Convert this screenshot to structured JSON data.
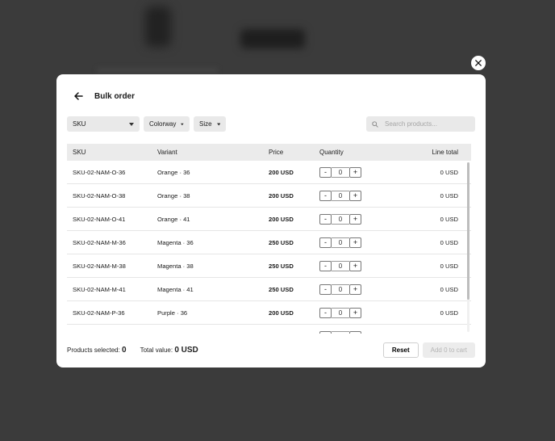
{
  "modal": {
    "title": "Bulk order"
  },
  "filters": {
    "sku": "SKU",
    "colorway": "Colorway",
    "size": "Size"
  },
  "search": {
    "placeholder": "Search products..."
  },
  "table": {
    "headers": {
      "sku": "SKU",
      "variant": "Variant",
      "price": "Price",
      "quantity": "Quantity",
      "line_total": "Line total"
    },
    "rows": [
      {
        "sku": "SKU-02-NAM-O-36",
        "variant": "Orange · 36",
        "price": "200 USD",
        "qty": "0",
        "total": "0 USD"
      },
      {
        "sku": "SKU-02-NAM-O-38",
        "variant": "Orange · 38",
        "price": "200 USD",
        "qty": "0",
        "total": "0 USD"
      },
      {
        "sku": "SKU-02-NAM-O-41",
        "variant": "Orange · 41",
        "price": "200 USD",
        "qty": "0",
        "total": "0 USD"
      },
      {
        "sku": "SKU-02-NAM-M-36",
        "variant": "Magenta · 36",
        "price": "250 USD",
        "qty": "0",
        "total": "0 USD"
      },
      {
        "sku": "SKU-02-NAM-M-38",
        "variant": "Magenta · 38",
        "price": "250 USD",
        "qty": "0",
        "total": "0 USD"
      },
      {
        "sku": "SKU-02-NAM-M-41",
        "variant": "Magenta · 41",
        "price": "250 USD",
        "qty": "0",
        "total": "0 USD"
      },
      {
        "sku": "SKU-02-NAM-P-36",
        "variant": "Purple · 36",
        "price": "200 USD",
        "qty": "0",
        "total": "0 USD"
      },
      {
        "sku": "",
        "variant": "",
        "price": "",
        "qty": "",
        "total": ""
      }
    ],
    "stepper": {
      "minus": "-",
      "plus": "+"
    }
  },
  "footer": {
    "products_selected_label": "Products selected:",
    "products_selected_value": "0",
    "total_value_label": "Total value:",
    "total_value_value": "0 USD",
    "reset_label": "Reset",
    "add_label": "Add 0 to cart"
  },
  "icons": {
    "close": "close-icon",
    "back": "arrow-left-icon",
    "chevron": "chevron-down-icon",
    "search": "search-icon"
  }
}
